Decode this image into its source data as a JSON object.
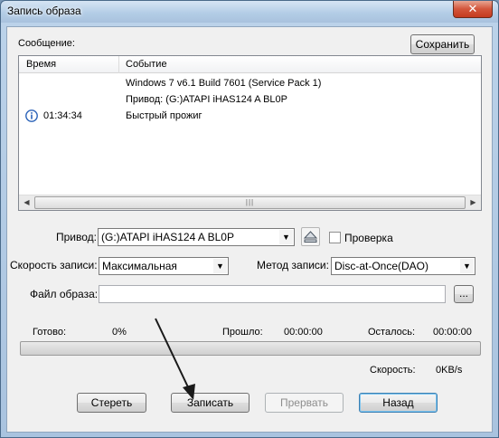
{
  "window": {
    "title": "Запись образа",
    "close_symbol": "✕"
  },
  "log": {
    "label": "Сообщение:",
    "save_button": "Сохранить",
    "columns": [
      "Время",
      "Событие"
    ],
    "rows": [
      {
        "time": "",
        "event": "Windows 7 v6.1 Build 7601 (Service Pack 1)",
        "icon": ""
      },
      {
        "time": "",
        "event": "Привод: (G:)ATAPI  iHAS124  A    BL0P",
        "icon": ""
      },
      {
        "time": "01:34:34",
        "event": "Быстрый прожиг",
        "icon": "info-icon"
      }
    ]
  },
  "drive": {
    "label": "Привод:",
    "value": "(G:)ATAPI  iHAS124  A    BL0P",
    "verify_label": "Проверка",
    "verify_checked": false
  },
  "speed": {
    "label": "Скорость записи:",
    "value": "Максимальная"
  },
  "method": {
    "label": "Метод записи:",
    "value": "Disc-at-Once(DAO)"
  },
  "image_file": {
    "label": "Файл образа:",
    "value": "",
    "browse_label": "..."
  },
  "status": {
    "done_label": "Готово:",
    "done_value": "0%",
    "elapsed_label": "Прошло:",
    "elapsed_value": "00:00:00",
    "remaining_label": "Осталось:",
    "remaining_value": "00:00:00",
    "speed_label": "Скорость:",
    "speed_value": "0KB/s",
    "progress_fraction": 0
  },
  "buttons": {
    "erase": "Стереть",
    "burn": "Записать",
    "abort": "Прервать",
    "back": "Назад"
  },
  "colors": {
    "info_icon": "#2a62b8",
    "default_button_border": "#3c7fb1"
  }
}
